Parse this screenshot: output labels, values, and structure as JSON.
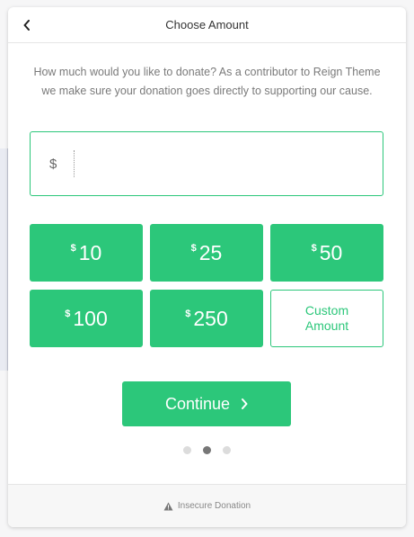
{
  "header": {
    "title": "Choose Amount",
    "back_icon": "chevron-left-icon"
  },
  "description": "How much would you like to donate? As a contributor to Reign Theme we make sure your donation goes directly to supporting our cause.",
  "amount_field": {
    "currency_symbol": "$",
    "value": ""
  },
  "preset_amounts": [
    {
      "symbol": "$",
      "value": "10"
    },
    {
      "symbol": "$",
      "value": "25"
    },
    {
      "symbol": "$",
      "value": "50"
    },
    {
      "symbol": "$",
      "value": "100"
    },
    {
      "symbol": "$",
      "value": "250"
    }
  ],
  "custom_amount_label": "Custom Amount",
  "continue_label": "Continue",
  "pagination": {
    "total": 3,
    "active_index": 1
  },
  "footer": {
    "text": "Insecure Donation",
    "icon": "warning-icon"
  },
  "colors": {
    "accent": "#2cc77a",
    "text_muted": "#7a7a7a"
  }
}
